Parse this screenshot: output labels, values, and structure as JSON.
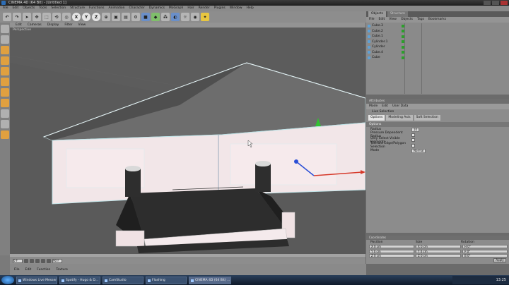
{
  "window": {
    "title": "CINEMA 4D (64 Bit) - [Untitled 1]"
  },
  "menubar": [
    "File",
    "Edit",
    "Objects",
    "Tools",
    "Selection",
    "Structure",
    "Functions",
    "Animation",
    "Character",
    "Dynamics",
    "MoGraph",
    "Hair",
    "Render",
    "Plugins",
    "Window",
    "Help"
  ],
  "toolbar": {
    "axis_x": "X",
    "axis_y": "Y",
    "axis_z": "Z"
  },
  "viewport": {
    "menu": [
      "Edit",
      "Cameras",
      "Display",
      "Filter",
      "View"
    ],
    "label": "Perspective"
  },
  "object_manager": {
    "tabs": [
      "Objects",
      "Structure"
    ],
    "menu": [
      "File",
      "Edit",
      "View",
      "Objects",
      "Tags",
      "Bookmarks"
    ],
    "objects": [
      "Cube.3",
      "Cube.2",
      "Cube.1",
      "Cylinder.1",
      "Cylinder",
      "Cube.4",
      "Cube"
    ]
  },
  "attribute_manager": {
    "header": "Attributes",
    "menu": [
      "Mode",
      "Edit",
      "User Data"
    ],
    "object_name": "Live Selection",
    "tabs": [
      "Options",
      "Modeling Axis",
      "Soft Selection"
    ],
    "section": "Options",
    "props": [
      {
        "label": "Radius",
        "value": "10"
      },
      {
        "label": "Pressure Dependent Radius",
        "checkbox": true
      },
      {
        "label": "Only Select Visible Elements",
        "checkbox": true
      },
      {
        "label": "Tolerant Edge/Polygon Selection",
        "checkbox": true
      },
      {
        "label": "Mode",
        "value": "Normal"
      }
    ]
  },
  "coord_manager": {
    "header": "Coordinates",
    "columns": [
      "Position",
      "Size",
      "Rotation"
    ],
    "rows": [
      [
        "X  0 cm",
        "X  0 cm",
        "H  0°"
      ],
      [
        "Y  0 cm",
        "Y  0 cm",
        "P  0°"
      ],
      [
        "Z  0 cm",
        "Z  0 cm",
        "B  0°"
      ]
    ],
    "apply": "Apply"
  },
  "timeline": {
    "frame": "0 F",
    "end": "90 F"
  },
  "material_manager": {
    "menu": [
      "File",
      "Edit",
      "Function",
      "Texture"
    ]
  },
  "taskbar": {
    "tasks": [
      "Windows Live Messenger",
      "Spotify - Hugo & D...",
      "CamStudio",
      "Flashing",
      "CINEMA 4D (64 Bit) ..."
    ],
    "clock": "13:25"
  },
  "colors": {
    "viewport_bg": "#5c5c5c",
    "house_wall": "#f0e4e6",
    "roof": "#6b6b6b",
    "accent_green": "#2c9f2c"
  }
}
